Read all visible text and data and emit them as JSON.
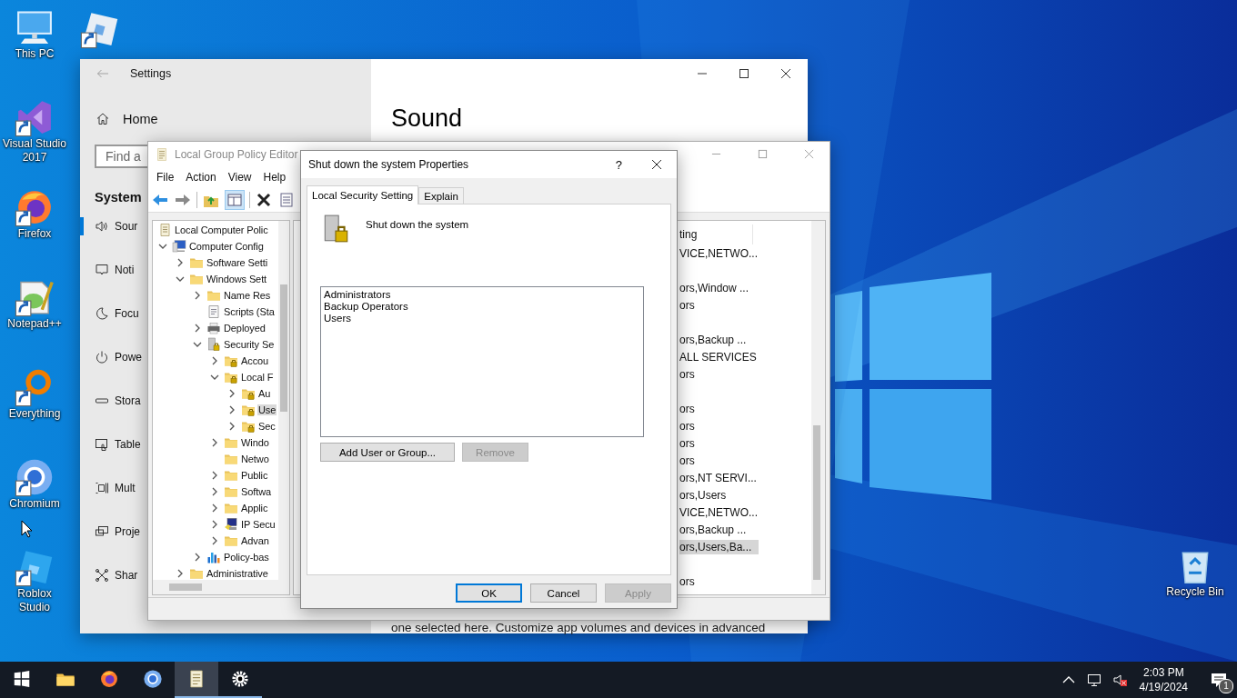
{
  "desktop": {
    "icons": [
      {
        "label": "This PC",
        "kind": "pc",
        "shortcut": false
      },
      {
        "label": "Visual Studio 2017",
        "kind": "vs",
        "shortcut": true
      },
      {
        "label": "Firefox",
        "kind": "firefox",
        "shortcut": true
      },
      {
        "label": "Notepad++",
        "kind": "notepad",
        "shortcut": true
      },
      {
        "label": "Everything",
        "kind": "everything",
        "shortcut": true
      },
      {
        "label": "Chromium",
        "kind": "chromium",
        "shortcut": true
      },
      {
        "label": "Roblox Studio",
        "kind": "roblox",
        "shortcut": true
      }
    ],
    "covered_icons": [
      {
        "kind": "roblox-player",
        "shortcut": true
      }
    ],
    "recycle_bin": {
      "label": "Recycle Bin",
      "kind": "recycle"
    }
  },
  "settings": {
    "title": "Settings",
    "home": "Home",
    "search": {
      "placeholder": "Find a"
    },
    "section": "System",
    "nav": [
      {
        "label": "Sour",
        "kind": "sound",
        "selected": true
      },
      {
        "label": "Noti",
        "kind": "notify",
        "selected": false
      },
      {
        "label": "Focu",
        "kind": "moon",
        "selected": false
      },
      {
        "label": "Powe",
        "kind": "power",
        "selected": false
      },
      {
        "label": "Stora",
        "kind": "storage",
        "selected": false
      },
      {
        "label": "Table",
        "kind": "tablet",
        "selected": false
      },
      {
        "label": "Mult",
        "kind": "multi",
        "selected": false
      },
      {
        "label": "Proje",
        "kind": "project",
        "selected": false
      },
      {
        "label": "Shar",
        "kind": "share",
        "selected": false
      }
    ],
    "heading": "Sound",
    "description": "one selected here. Customize app volumes and devices in advanced"
  },
  "gpe": {
    "title": "Local Group Policy Editor",
    "menu": [
      "File",
      "Action",
      "View",
      "Help"
    ],
    "tree": [
      {
        "label": "Local Computer Polic",
        "kind": "scroll",
        "selected": false,
        "children": [
          {
            "label": "Computer Config",
            "kind": "computer",
            "expanded": true,
            "selected": false,
            "children": [
              {
                "label": "Software Setti",
                "kind": "folder",
                "expanded": false,
                "selected": false
              },
              {
                "label": "Windows Sett",
                "kind": "folder",
                "expanded": true,
                "selected": false,
                "children": [
                  {
                    "label": "Name Res",
                    "kind": "folder",
                    "expanded": false,
                    "selected": false
                  },
                  {
                    "label": "Scripts (Sta",
                    "kind": "script",
                    "selected": false
                  },
                  {
                    "label": "Deployed",
                    "kind": "printer",
                    "expanded": false,
                    "selected": false
                  },
                  {
                    "label": "Security Se",
                    "kind": "security",
                    "expanded": true,
                    "selected": false,
                    "children": [
                      {
                        "label": "Accou",
                        "kind": "lockfolder",
                        "expanded": false,
                        "selected": false
                      },
                      {
                        "label": "Local F",
                        "kind": "lockfolder",
                        "expanded": true,
                        "selected": false,
                        "children": [
                          {
                            "label": "Au",
                            "kind": "lockfolder",
                            "expanded": false,
                            "selected": false
                          },
                          {
                            "label": "Use",
                            "kind": "lockfolder",
                            "expanded": false,
                            "selected": true
                          },
                          {
                            "label": "Sec",
                            "kind": "lockfolder",
                            "expanded": false,
                            "selected": false
                          }
                        ]
                      },
                      {
                        "label": "Windo",
                        "kind": "folder",
                        "expanded": false,
                        "selected": false
                      },
                      {
                        "label": "Netwo",
                        "kind": "folder",
                        "selected": false
                      },
                      {
                        "label": "Public",
                        "kind": "folder",
                        "expanded": false,
                        "selected": false
                      },
                      {
                        "label": "Softwa",
                        "kind": "folder",
                        "expanded": false,
                        "selected": false
                      },
                      {
                        "label": "Applic",
                        "kind": "folder",
                        "expanded": false,
                        "selected": false
                      },
                      {
                        "label": "IP Secu",
                        "kind": "ipsec",
                        "expanded": false,
                        "selected": false
                      },
                      {
                        "label": "Advan",
                        "kind": "folder",
                        "expanded": false,
                        "selected": false
                      }
                    ]
                  },
                  {
                    "label": "Policy-bas",
                    "kind": "chart",
                    "expanded": false,
                    "selected": false
                  }
                ]
              },
              {
                "label": "Administrative",
                "kind": "folder",
                "expanded": false,
                "selected": false
              }
            ]
          }
        ]
      }
    ],
    "list": {
      "header": "ting",
      "rows": [
        {
          "text": "VICE,NETWO...",
          "selected": false
        },
        {
          "selected": false
        },
        {
          "text": "ors,Window ...",
          "selected": false
        },
        {
          "text": "ors",
          "selected": false
        },
        {
          "selected": false
        },
        {
          "text": "ors,Backup ...",
          "selected": false
        },
        {
          "text": "ALL SERVICES",
          "selected": false
        },
        {
          "text": "ors",
          "selected": false
        },
        {
          "selected": false
        },
        {
          "text": "ors",
          "selected": false
        },
        {
          "text": "ors",
          "selected": false
        },
        {
          "text": "ors",
          "selected": false
        },
        {
          "text": "ors",
          "selected": false
        },
        {
          "text": "ors,NT SERVI...",
          "selected": false
        },
        {
          "text": "ors,Users",
          "selected": false
        },
        {
          "text": "VICE,NETWO...",
          "selected": false
        },
        {
          "text": "ors,Backup ...",
          "selected": false
        },
        {
          "text": "ors,Users,Ba...",
          "selected": true
        },
        {
          "selected": false
        },
        {
          "text": "ors",
          "selected": false
        }
      ]
    }
  },
  "dialog": {
    "title": "Shut down the system Properties",
    "help": "?",
    "tabs": [
      {
        "label": "Local Security Setting",
        "selected": true
      },
      {
        "label": "Explain",
        "selected": false
      }
    ],
    "policy": "Shut down the system",
    "members": [
      "Administrators",
      "Backup Operators",
      "Users"
    ],
    "buttons": [
      {
        "label": "Add User or Group...",
        "disabled": false
      },
      {
        "label": "Remove",
        "disabled": true
      }
    ],
    "footer_buttons": [
      {
        "label": "OK",
        "default": true,
        "disabled": false
      },
      {
        "label": "Cancel",
        "default": false,
        "disabled": false
      },
      {
        "label": "Apply",
        "default": false,
        "disabled": true
      }
    ]
  },
  "taskbar": {
    "apps": [
      {
        "kind": "explorer",
        "active": false,
        "running": false
      },
      {
        "kind": "firefox",
        "active": false,
        "running": false
      },
      {
        "kind": "chromium",
        "active": false,
        "running": false
      },
      {
        "kind": "gpe",
        "active": true,
        "running": true
      },
      {
        "kind": "settings",
        "active": false,
        "running": true
      }
    ],
    "volume_muted": true,
    "time": "2:03 PM",
    "date": "4/19/2024",
    "notifications": "1"
  }
}
